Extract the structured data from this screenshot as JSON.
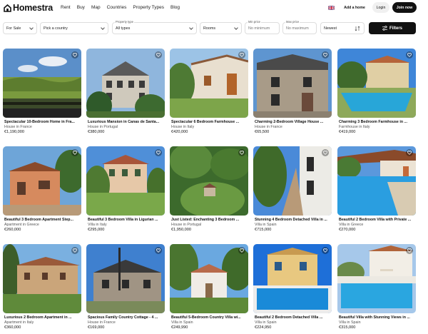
{
  "header": {
    "logo_text": "Homestra",
    "nav": [
      "Rent",
      "Buy",
      "Map",
      "Countries",
      "Property Types",
      "Blog"
    ],
    "add_home": "Add a home",
    "login": "Login",
    "join": "Join now"
  },
  "filters": {
    "sale": "For Sale",
    "country_placeholder": "Pick a country",
    "property_type_label": "Property type",
    "property_type_value": "All types",
    "rooms": "Rooms",
    "min_label": "Min price",
    "min_placeholder": "No minimum",
    "max_label": "Max price",
    "max_placeholder": "No maximum",
    "sort": "Newest",
    "filters_button": "Filters"
  },
  "listings": [
    {
      "title": "Spectacular 10-Bedroom Home in Fra...",
      "subtitle": "House in France",
      "price": "€1,190,000"
    },
    {
      "title": "Luxurious Mansion in Canas de Santa...",
      "subtitle": "House in Portugal",
      "price": "€380,000"
    },
    {
      "title": "Spectacular 6 Bedroom Farmhouse ...",
      "subtitle": "House in Italy",
      "price": "€420,000"
    },
    {
      "title": "Charming 2-Bedroom Village House ...",
      "subtitle": "House in France",
      "price": "€65,500"
    },
    {
      "title": "Charming 3 Bedroom Farmhouse in ...",
      "subtitle": "Farmhouse in Italy",
      "price": "€419,000"
    },
    {
      "title": "Beautiful 3 Bedroom Apartment Step...",
      "subtitle": "Apartment in Greece",
      "price": "€260,000"
    },
    {
      "title": "Beautiful 3 Bedroom Villa in Ligurian ...",
      "subtitle": "Villa in Italy",
      "price": "€295,000"
    },
    {
      "title": "Just Listed: Enchanting 3 Bedroom ...",
      "subtitle": "House in Portugal",
      "price": "€1,950,000"
    },
    {
      "title": "Stunning 4 Bedroom Detached Villa in ...",
      "subtitle": "Villa in Spain",
      "price": "€715,000"
    },
    {
      "title": "Beautiful 2 Bedroom Villa with Private ...",
      "subtitle": "Villa in Greece",
      "price": "€270,000"
    },
    {
      "title": "Luxurious 2 Bedroom Apartment in ...",
      "subtitle": "Apartment in Italy",
      "price": "€360,000"
    },
    {
      "title": "Spacious Family Country Cottage - 4 ...",
      "subtitle": "House in France",
      "price": "€169,000"
    },
    {
      "title": "Beautiful 5-Bedroom Country Villa wi...",
      "subtitle": "Villa in Spain",
      "price": "€249,990"
    },
    {
      "title": "Beautiful 2 Bedroom Detached Villa ...",
      "subtitle": "Villa in Spain",
      "price": "€224,950"
    },
    {
      "title": "Beautiful Villa with Stunning Views in ...",
      "subtitle": "Villa in Spain",
      "price": "€315,000"
    }
  ]
}
